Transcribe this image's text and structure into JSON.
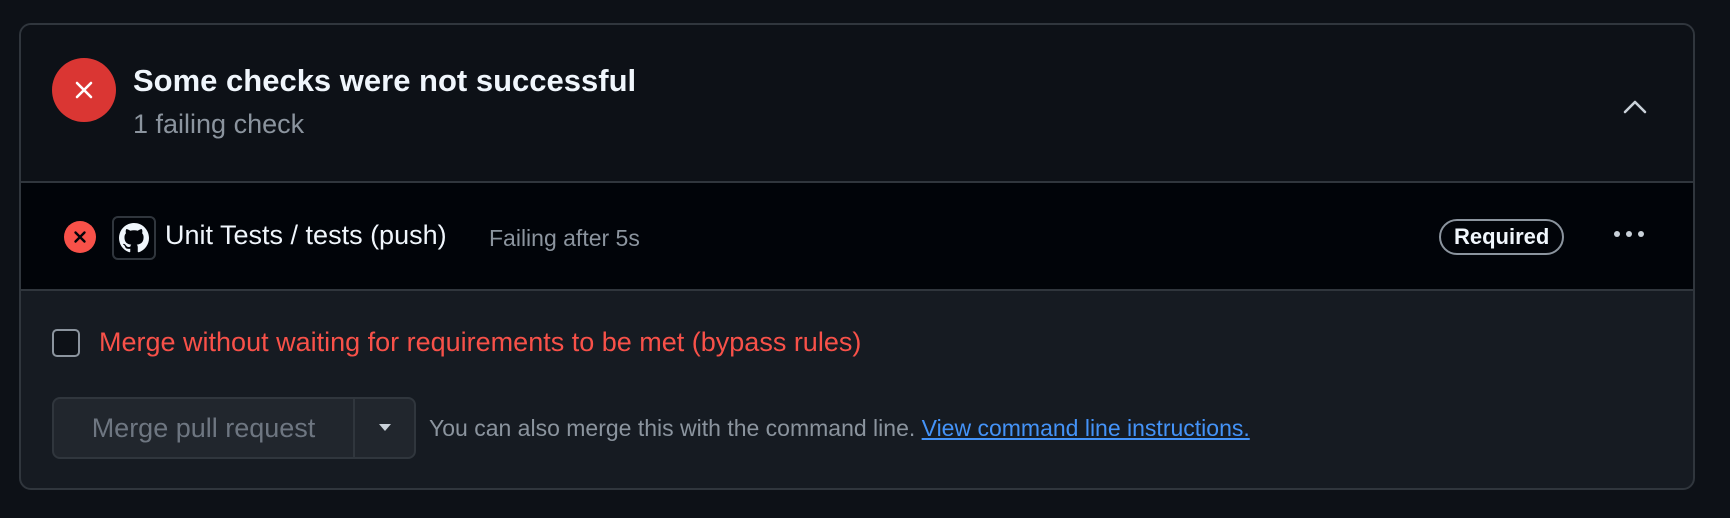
{
  "header": {
    "title": "Some checks were not successful",
    "subtitle": "1 failing check",
    "status_icon": "x-circle-fill-icon",
    "collapse_icon": "chevron-up-icon"
  },
  "checks": [
    {
      "status_icon": "x-circle-fill-icon",
      "app_icon": "github-mark-icon",
      "name": "Unit Tests / tests (push)",
      "status": "Failing after 5s",
      "badge": "Required",
      "more_icon": "kebab-horizontal-icon"
    }
  ],
  "bypass": {
    "label": "Merge without waiting for requirements to be met (bypass rules)",
    "checked": false
  },
  "merge": {
    "button_label": "Merge pull request",
    "dropdown_icon": "triangle-down-icon",
    "hint_text": "You can also merge this with the command line.",
    "hint_link": "View command line instructions."
  },
  "colors": {
    "background": "#0d1117",
    "danger": "#da3633",
    "danger_text": "#f85149",
    "link": "#4493f8",
    "muted": "#8b949e",
    "border": "#30363d"
  }
}
